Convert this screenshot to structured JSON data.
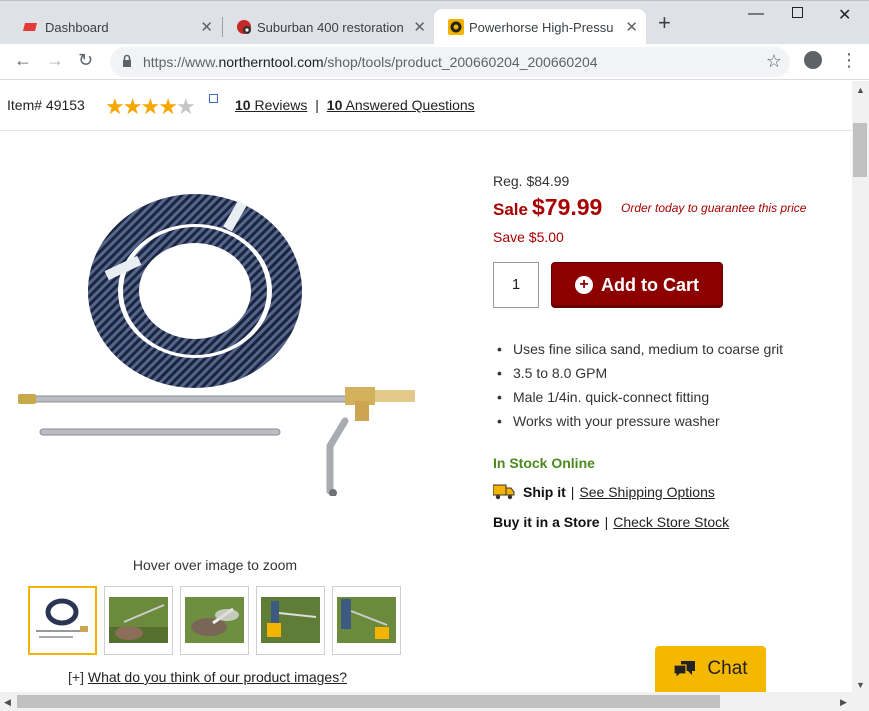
{
  "browser": {
    "tabs": [
      {
        "title": "Dashboard",
        "icon": "red-parallelogram-icon",
        "active": false
      },
      {
        "title": "Suburban 400 restoration -",
        "icon": "pinterest-icon",
        "active": false
      },
      {
        "title": "Powerhorse High-Pressure",
        "icon": "powerhorse-icon",
        "active": true
      }
    ],
    "url_prefix": "https://www.",
    "url_host": "northerntool.com",
    "url_path": "/shop/tools/product_200660204_200660204"
  },
  "product": {
    "item_label": "Item# 49153",
    "rating_stars": 4,
    "rating_max": 5,
    "reviews_count": "10",
    "reviews_text": " Reviews",
    "questions_count": "10",
    "questions_text": " Answered Questions",
    "zoom_note": "Hover over image to zoom",
    "image_feedback_prefix": "[+] ",
    "image_feedback_link": "What do you think of our product images?"
  },
  "pricing": {
    "reg": "Reg. $84.99",
    "sale_label": "Sale",
    "sale_price": "$79.99",
    "guarantee": "Order today to guarantee this price",
    "save": "Save $5.00",
    "quantity": "1",
    "add_to_cart": "Add to Cart"
  },
  "features": [
    "Uses fine silica sand, medium to coarse grit",
    "3.5 to 8.0 GPM",
    "Male 1/4in. quick-connect fitting",
    "Works with your pressure washer"
  ],
  "availability": {
    "in_stock": "In Stock Online",
    "ship_label": "Ship it",
    "ship_link": "See Shipping Options",
    "store_label": "Buy it in a Store",
    "store_link": "Check Store Stock"
  },
  "chat": {
    "label": "Chat"
  },
  "colors": {
    "sale_red": "#a80000",
    "cart_red": "#8d0000",
    "stock_green": "#4b8a1e",
    "chat_yellow": "#f5b800"
  }
}
